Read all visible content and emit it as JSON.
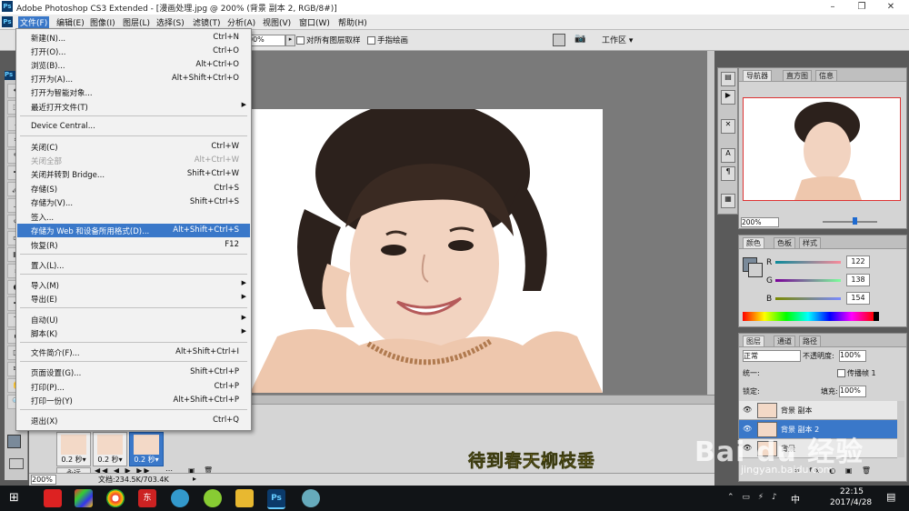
{
  "window": {
    "title": "Adobe Photoshop CS3 Extended - [漫画处理.jpg @ 200% (背景 副本 2, RGB/8#)]",
    "app_icon": "Ps",
    "controls": [
      "minimize-icon",
      "restore-icon",
      "close-icon"
    ]
  },
  "menubar": {
    "items": [
      "文件(F)",
      "编辑(E)",
      "图像(I)",
      "图层(L)",
      "选择(S)",
      "滤镜(T)",
      "分析(A)",
      "视图(V)",
      "窗口(W)",
      "帮助(H)"
    ],
    "active_index": 0
  },
  "options_bar": {
    "zoom_value": "00%",
    "sample_all_layers": "对所有图层取样",
    "finger_painting": "手指绘画",
    "workspace": "工作区 ▾"
  },
  "file_menu": {
    "items": [
      {
        "label": "新建(N)...",
        "shortcut": "Ctrl+N"
      },
      {
        "label": "打开(O)...",
        "shortcut": "Ctrl+O"
      },
      {
        "label": "浏览(B)...",
        "shortcut": "Alt+Ctrl+O"
      },
      {
        "label": "打开为(A)...",
        "shortcut": "Alt+Shift+Ctrl+O"
      },
      {
        "label": "打开为智能对象...",
        "shortcut": ""
      },
      {
        "label": "最近打开文件(T)",
        "shortcut": "",
        "submenu": true
      },
      {
        "label": "Device Central...",
        "shortcut": ""
      },
      {
        "label": "关闭(C)",
        "shortcut": "Ctrl+W"
      },
      {
        "label": "关闭全部",
        "shortcut": "Alt+Ctrl+W",
        "disabled": true
      },
      {
        "label": "关闭并转到 Bridge...",
        "shortcut": "Shift+Ctrl+W"
      },
      {
        "label": "存储(S)",
        "shortcut": "Ctrl+S"
      },
      {
        "label": "存储为(V)...",
        "shortcut": "Shift+Ctrl+S"
      },
      {
        "label": "签入...",
        "shortcut": ""
      },
      {
        "label": "存储为 Web 和设备所用格式(D)...",
        "shortcut": "Alt+Shift+Ctrl+S",
        "highlighted": true
      },
      {
        "label": "恢复(R)",
        "shortcut": "F12"
      },
      {
        "label": "置入(L)...",
        "shortcut": ""
      },
      {
        "label": "导入(M)",
        "shortcut": "",
        "submenu": true
      },
      {
        "label": "导出(E)",
        "shortcut": "",
        "submenu": true
      },
      {
        "label": "自动(U)",
        "shortcut": "",
        "submenu": true
      },
      {
        "label": "脚本(K)",
        "shortcut": "",
        "submenu": true
      },
      {
        "label": "文件简介(F)...",
        "shortcut": "Alt+Shift+Ctrl+I"
      },
      {
        "label": "页面设置(G)...",
        "shortcut": "Shift+Ctrl+P"
      },
      {
        "label": "打印(P)...",
        "shortcut": "Ctrl+P"
      },
      {
        "label": "打印一份(Y)",
        "shortcut": "Alt+Shift+Ctrl+P"
      },
      {
        "label": "退出(X)",
        "shortcut": "Ctrl+Q"
      }
    ]
  },
  "animation": {
    "frames": [
      {
        "delay": "0.2 秒▾",
        "selected": false
      },
      {
        "delay": "0.2 秒▾",
        "selected": false
      },
      {
        "delay": "0.2 秒▾",
        "selected": true
      }
    ],
    "loop": "永远",
    "caption": "待到春天柳枝垂"
  },
  "status": {
    "zoom": "200%",
    "doc_size": "文档:234.5K/703.4K"
  },
  "navigator": {
    "tabs": [
      "导航器",
      "直方图",
      "信息"
    ],
    "zoom": "200%"
  },
  "color_panel": {
    "tabs": [
      "颜色",
      "色板",
      "样式"
    ],
    "r_label": "R",
    "g_label": "G",
    "b_label": "B",
    "r": "122",
    "g": "138",
    "b": "154",
    "fg_color": "#7a8a9a"
  },
  "layers_panel": {
    "tabs": [
      "图层",
      "通道",
      "路径"
    ],
    "blend_mode": "正常",
    "opacity_label": "不透明度:",
    "opacity": "100%",
    "unify_label": "统一:",
    "propagate_label": "传播帧 1",
    "lock_label": "锁定:",
    "fill_label": "填充:",
    "fill": "100%",
    "layers": [
      {
        "name": "背景 副本",
        "selected": false
      },
      {
        "name": "背景 副本 2",
        "selected": true
      },
      {
        "name": "背景",
        "selected": false
      }
    ]
  },
  "watermark": {
    "brand": "Bai du 经验",
    "url": "jingyan.baidu.com"
  },
  "taskbar": {
    "time": "22:15",
    "date": "2017/4/28",
    "ime": "中"
  }
}
